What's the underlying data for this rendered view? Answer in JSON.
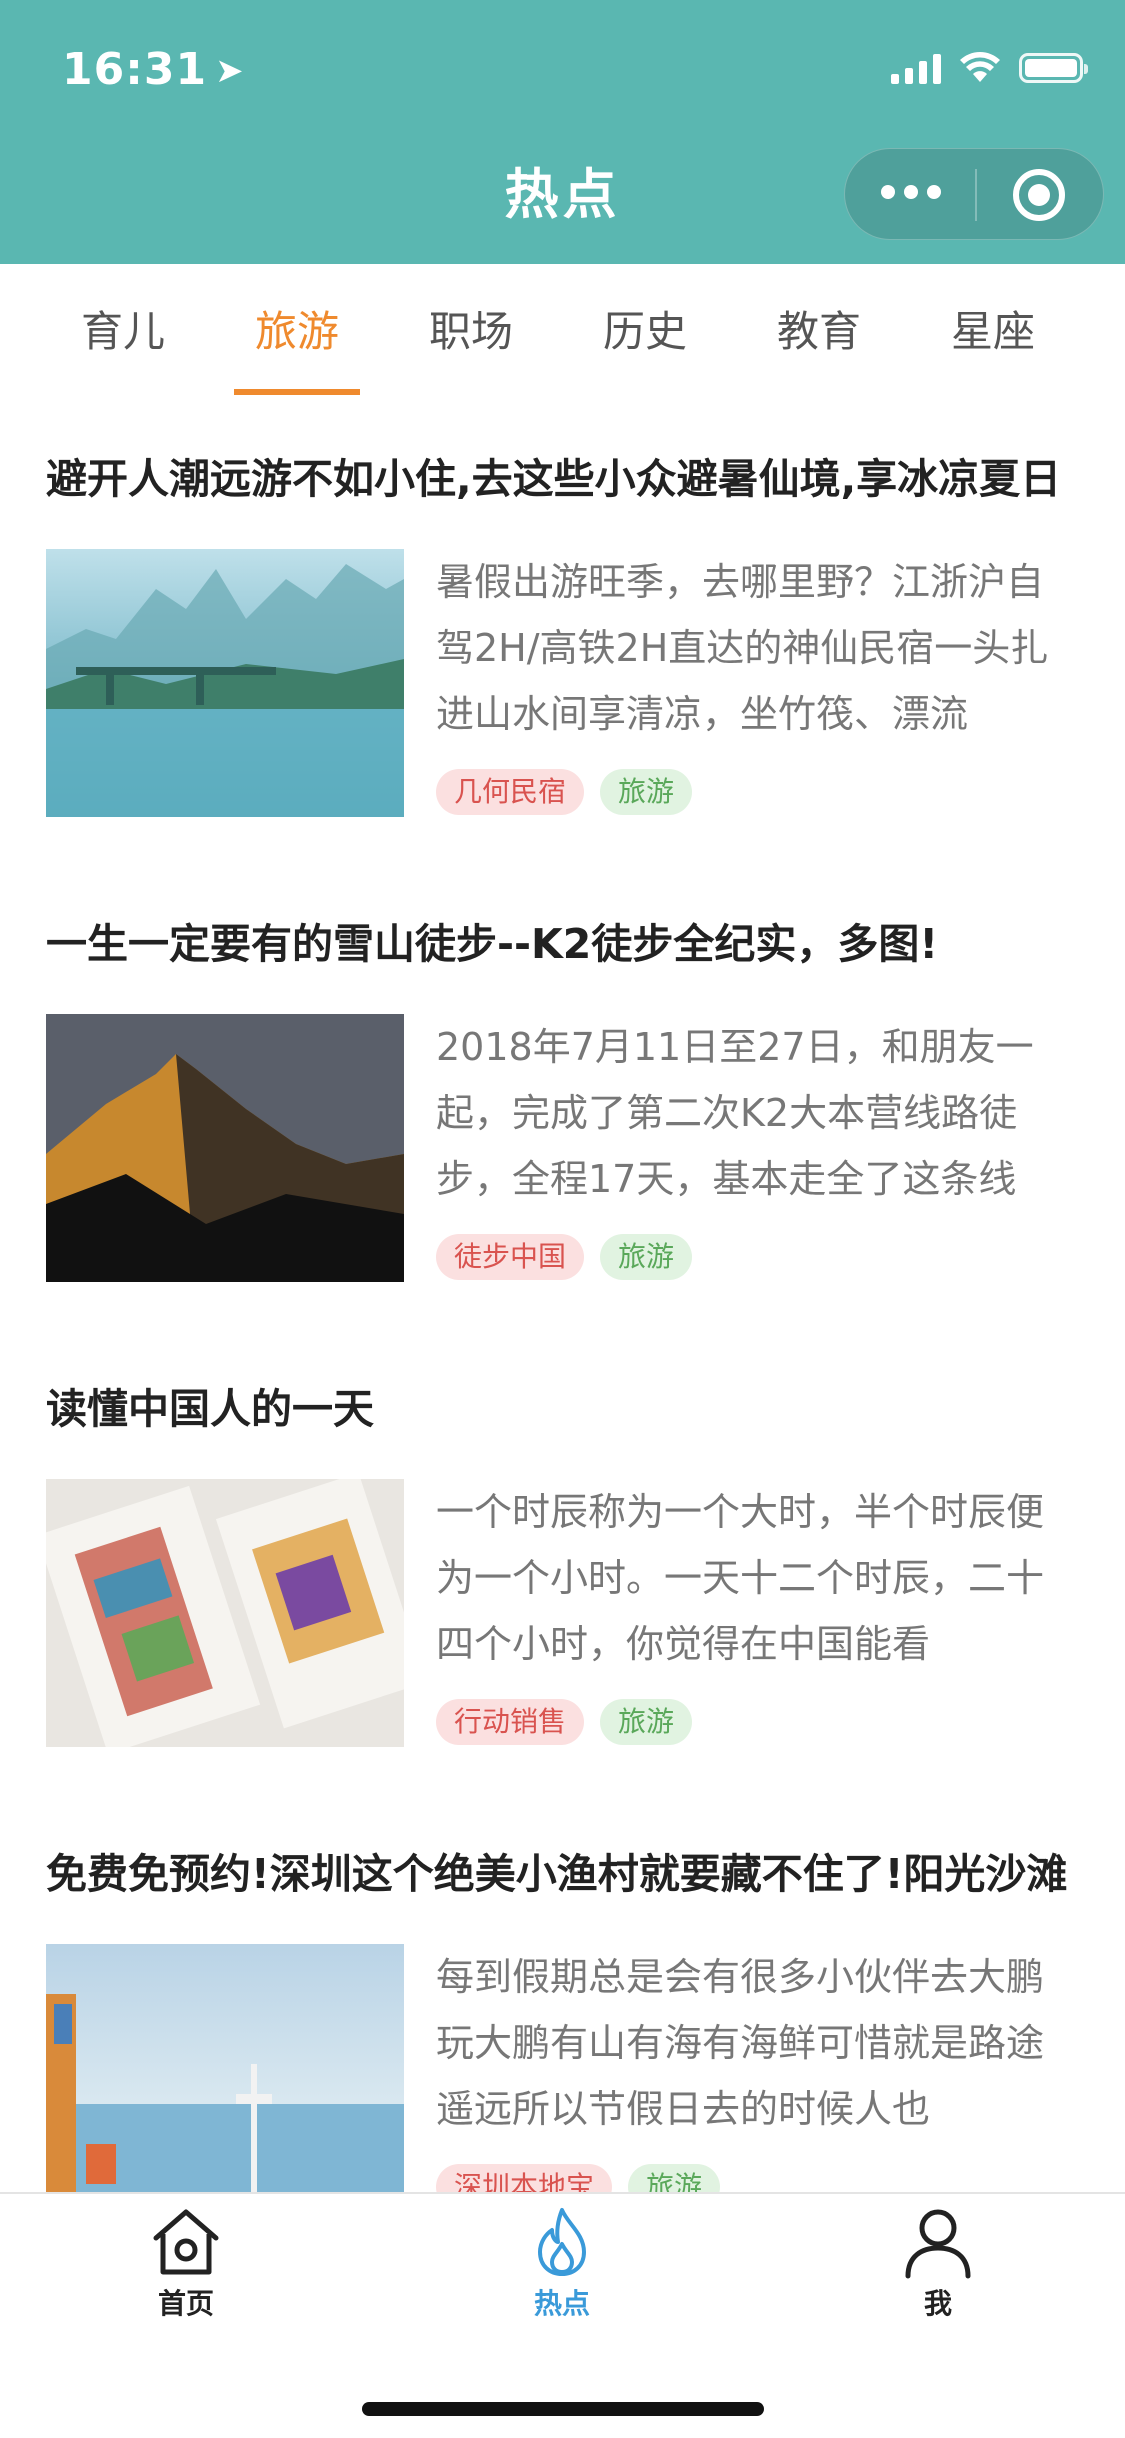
{
  "status_bar": {
    "time": "16:31"
  },
  "nav": {
    "title": "热点"
  },
  "tabs": [
    {
      "label": "育儿"
    },
    {
      "label": "旅游",
      "active": true
    },
    {
      "label": "职场"
    },
    {
      "label": "历史"
    },
    {
      "label": "教育"
    },
    {
      "label": "星座"
    }
  ],
  "articles": [
    {
      "title": "避开人潮远游不如小住,去这些小众避暑仙境,享冰凉夏日",
      "summary": "暑假出游旺季，去哪里野？江浙沪自驾2H/高铁2H直达的神仙民宿一头扎进山水间享清凉，坐竹筏、漂流",
      "tags": [
        "几何民宿",
        "旅游"
      ]
    },
    {
      "title": "一生一定要有的雪山徒步--K2徒步全纪实，多图!",
      "summary": "2018年7月11日至27日，和朋友一起，完成了第二次K2大本营线路徒步，全程17天，基本走全了这条线",
      "tags": [
        "徒步中国",
        "旅游"
      ]
    },
    {
      "title": "读懂中国人的一天",
      "summary": "一个时辰称为一个大时，半个时辰便为一个小时。一天十二个时辰，二十四个小时，你觉得在中国能看",
      "tags": [
        "行动销售",
        "旅游"
      ]
    },
    {
      "title": "免费免预约!深圳这个绝美小渔村就要藏不住了!阳光沙滩",
      "summary": "每到假期总是会有很多小伙伴去大鹏玩大鹏有山有海有海鲜可惜就是路途遥远所以节假日去的时候人也",
      "tags": [
        "深圳本地宝",
        "旅游"
      ]
    }
  ],
  "tabbar": [
    {
      "label": "首页",
      "icon": "home-icon"
    },
    {
      "label": "热点",
      "icon": "flame-icon",
      "active": true
    },
    {
      "label": "我",
      "icon": "user-icon"
    }
  ],
  "colors": {
    "header": "#5ab7b1",
    "accent": "#ef8a2e",
    "active_tabbar": "#3a9ad9",
    "source_tag_bg": "#fbe0e0",
    "category_tag_bg": "#e1f3e1"
  }
}
